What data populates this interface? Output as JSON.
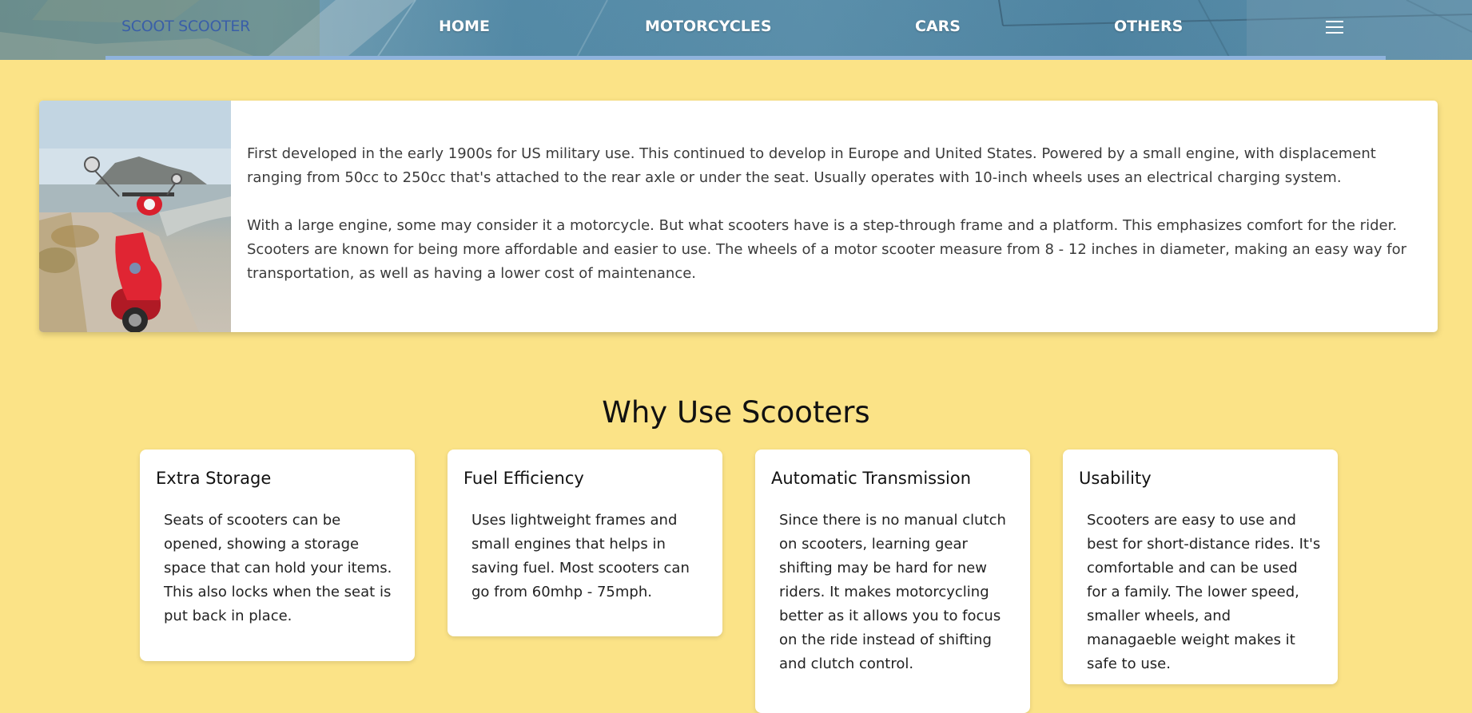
{
  "nav": {
    "brand": "SCOOT SCOOTER",
    "links": [
      "HOME",
      "MOTORCYCLES",
      "CARS",
      "OTHERS"
    ],
    "menu_icon": "hamburger-menu-icon",
    "colors": {
      "brand": "#3a5fa8",
      "link": "#ffffff",
      "underline": "#8fb3dc"
    }
  },
  "intro": {
    "image": "red-scooter-photo",
    "paragraphs": [
      "First developed in the early 1900s for US military use. This continued to develop in Europe and United States. Powered by a small engine, with displacement ranging from 50cc to 250cc that's attached to the rear axle or under the seat. Usually operates with 10-inch wheels uses an electrical charging system.",
      "With a large engine, some may consider it a motorcycle. But what scooters have is a step-through frame and a platform. This emphasizes comfort for the rider. Scooters are known for being more affordable and easier to use. The wheels of a motor scooter measure from 8 - 12 inches in diameter, making an easy way for transportation, as well as having a lower cost of maintenance."
    ]
  },
  "features": {
    "title": "Why Use Scooters",
    "cards": [
      {
        "title": "Extra Storage",
        "text": "Seats of scooters can be opened, showing a storage space that can hold your items. This also locks when the seat is put back in place."
      },
      {
        "title": "Fuel Efficiency",
        "text": "Uses lightweight frames and small engines that helps in saving fuel. Most scooters can go from 60mhp - 75mph."
      },
      {
        "title": "Automatic Transmission",
        "text": "Since there is no manual clutch on scooters, learning gear shifting may be hard for new riders. It makes motorcycling better as it allows you to focus on the ride instead of shifting and clutch control."
      },
      {
        "title": "Usability",
        "text": "Scooters are easy to use and best for short-distance rides. It's comfortable and can be used for a family. The lower speed, smaller wheels, and managaeble weight makes it safe to use."
      }
    ]
  },
  "theme": {
    "background": "#fbe387",
    "card": "#ffffff"
  }
}
